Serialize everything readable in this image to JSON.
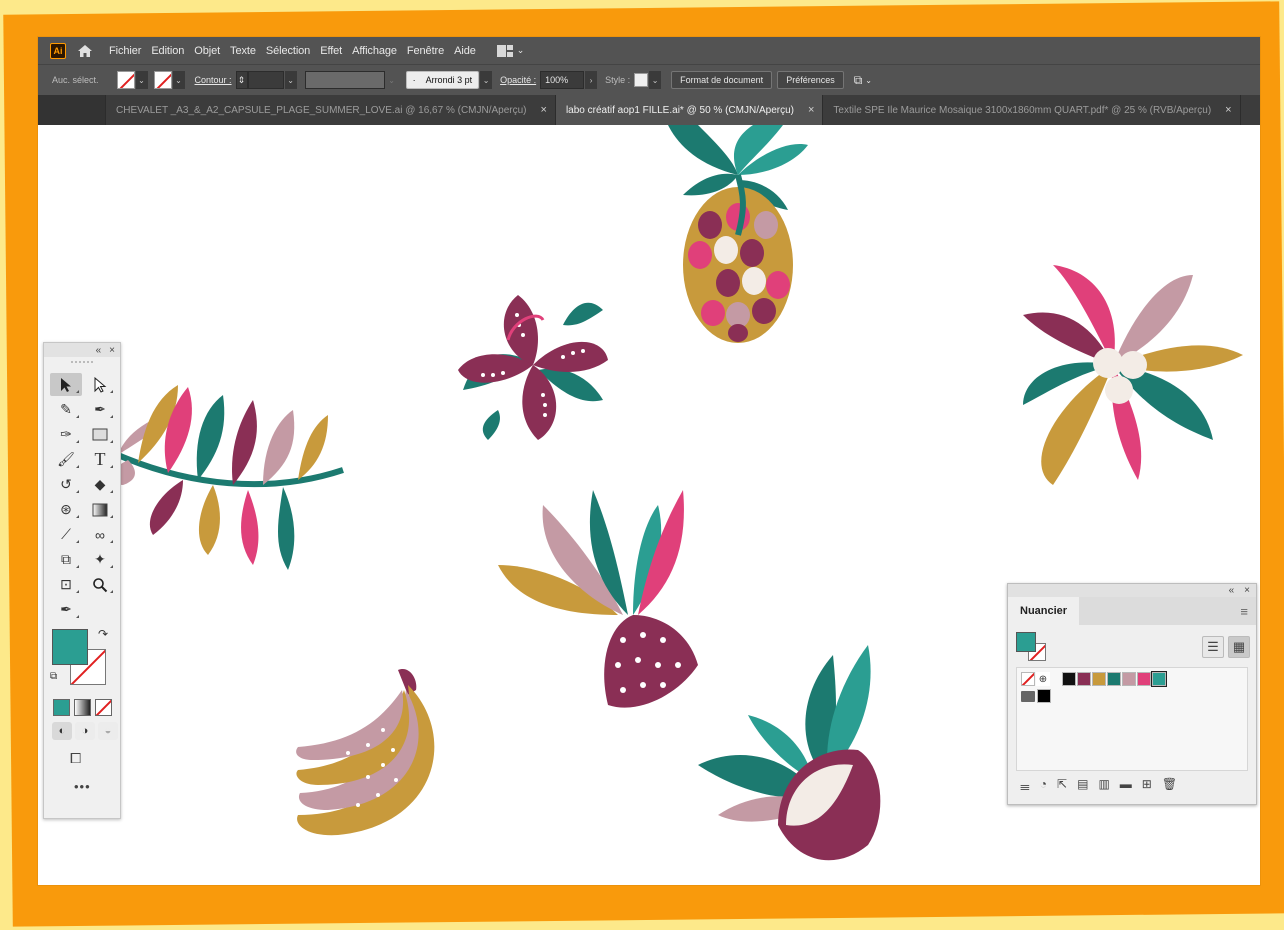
{
  "app": {
    "badge": "Ai"
  },
  "menu": [
    "Fichier",
    "Edition",
    "Objet",
    "Texte",
    "Sélection",
    "Effet",
    "Affichage",
    "Fenêtre",
    "Aide"
  ],
  "control": {
    "selection_label": "Auc. sélect.",
    "stroke_label": "Contour :",
    "brush_value": "Arrondi 3 pt",
    "opacity_label": "Opacité :",
    "opacity_value": "100%",
    "style_label": "Style :",
    "doc_format_button": "Format de document",
    "prefs_button": "Préférences"
  },
  "tabs": [
    {
      "title": "CHEVALET _A3_&_A2_CAPSULE_PLAGE_SUMMER_LOVE.ai @ 16,67 % (CMJN/Aperçu)",
      "active": false
    },
    {
      "title": "labo créatif aop1 FILLE.ai* @ 50 % (CMJN/Aperçu)",
      "active": true
    },
    {
      "title": "Textile SPE Ile Maurice Mosaique 3100x1860mm QUART.pdf* @ 25 % (RVB/Aperçu)",
      "active": false
    }
  ],
  "tools_panel": {
    "tools": [
      "selection-tool",
      "direct-selection-tool",
      "curvature-tool",
      "pen-tool",
      "pen-variant-tool",
      "rectangle-tool",
      "paintbrush-tool",
      "type-tool",
      "rotate-tool",
      "eraser-tool",
      "puppet-warp-tool",
      "gradient-tool",
      "eyedropper-tool",
      "blend-tool",
      "shape-builder-tool",
      "magic-wand-tool",
      "artboard-tool",
      "zoom-tool",
      "anchor-point-tool"
    ],
    "fill_color": "#2b9e92",
    "more_label": "•••"
  },
  "swatches_panel": {
    "title": "Nuancier",
    "swatches": [
      "#111111",
      "#8a2f55",
      "#c89a3c",
      "#1c7a70",
      "#c49aa4",
      "#e0407a",
      "#2b9e92"
    ],
    "group_swatch": "#000000"
  },
  "colors": {
    "teal": "#1c7a70",
    "teal_light": "#2b9e92",
    "burgundy": "#8a2f55",
    "pink": "#e0407a",
    "ochre": "#c89a3c",
    "mauve": "#c49aa4",
    "cream": "#f3ece6",
    "frame_orange": "#f99a0c",
    "frame_yellow": "#fde98a"
  }
}
